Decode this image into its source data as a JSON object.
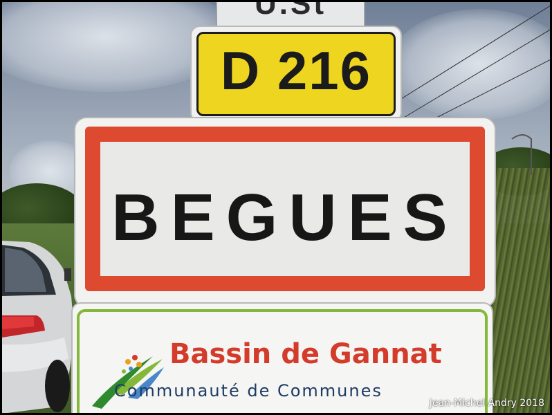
{
  "signs": {
    "top_partial": "U.St",
    "road_number": "D 216",
    "town_name": "BEGUES",
    "community_title": "Bassin de Gannat",
    "community_subtitle": "Communauté de Communes"
  },
  "credit": "Jean-Michel Andry 2018",
  "colors": {
    "road_sign_yellow": "#eed520",
    "town_border_red": "#dd4a2f",
    "community_red": "#d33b2a",
    "community_blue": "#1e3b63",
    "community_green": "#83b83a"
  },
  "icons": {
    "logo": "leaf-logo",
    "car": "car-icon"
  }
}
